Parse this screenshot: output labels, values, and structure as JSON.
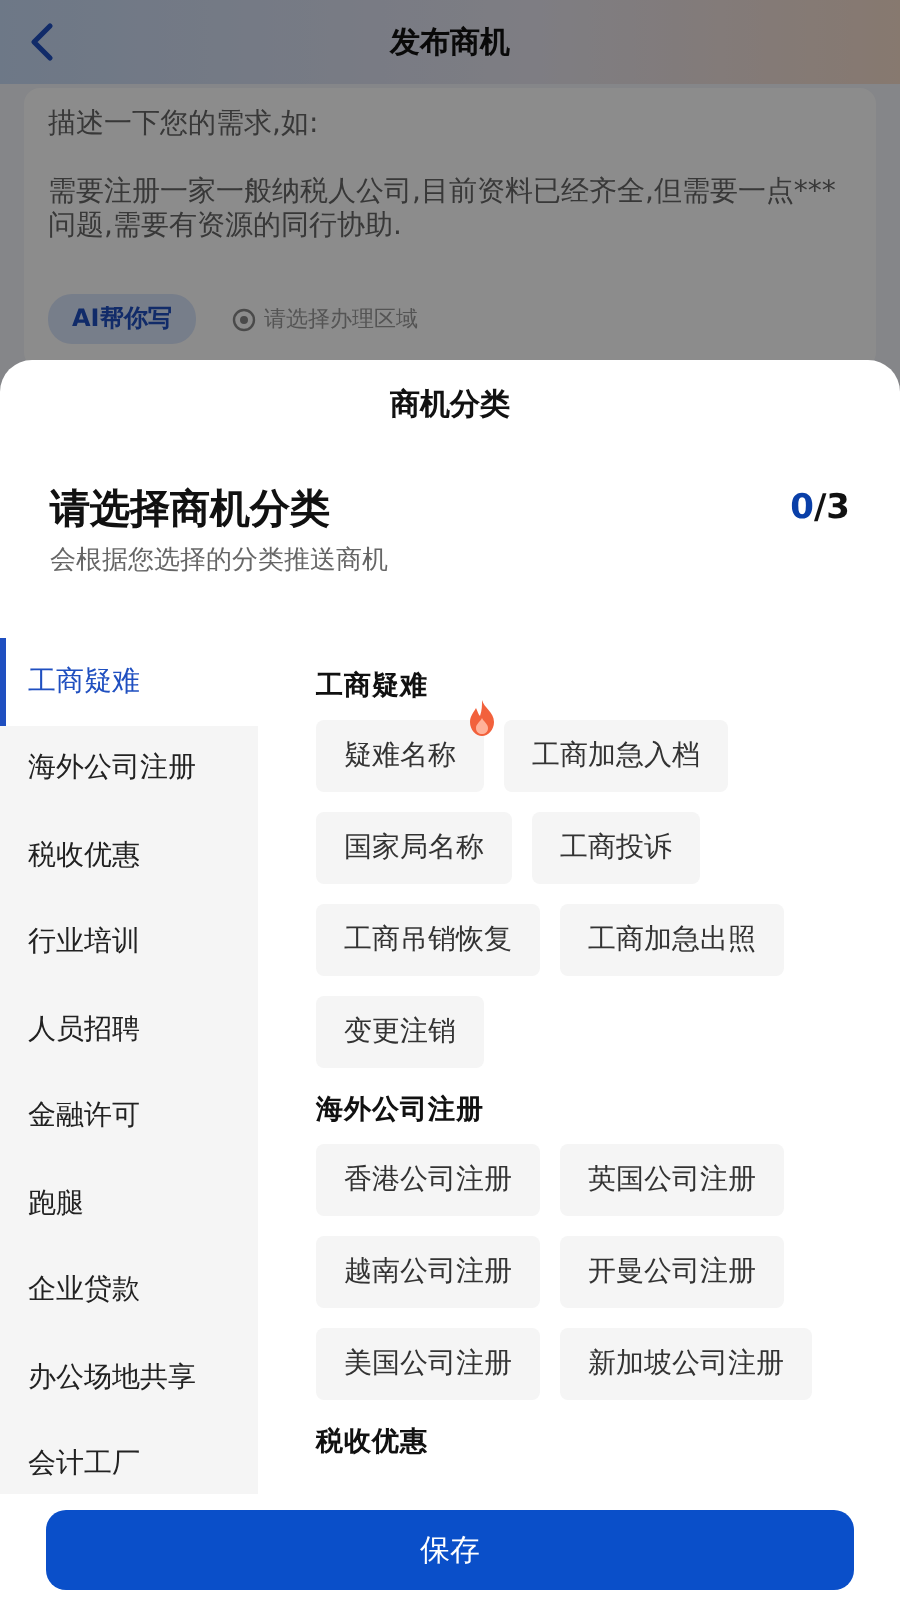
{
  "header": {
    "title": "发布商机"
  },
  "description": {
    "hint_title": "描述一下您的需求,如:",
    "hint_example": "需要注册一家一般纳税人公司,目前资料已经齐全,但需要一点***问题,需要有资源的同行协助.",
    "ai_button": "AI帮你写",
    "region_picker": "请选择办理区域"
  },
  "sheet": {
    "title": "商机分类",
    "heading": "请选择商机分类",
    "count": "0",
    "limit": "/3",
    "subtitle": "会根据您选择的分类推送商机",
    "categories": [
      {
        "label": "工商疑难",
        "selected": true
      },
      {
        "label": "海外公司注册",
        "selected": false
      },
      {
        "label": "税收优惠",
        "selected": false
      },
      {
        "label": "行业培训",
        "selected": false
      },
      {
        "label": "人员招聘",
        "selected": false
      },
      {
        "label": "金融许可",
        "selected": false
      },
      {
        "label": "跑腿",
        "selected": false
      },
      {
        "label": "企业贷款",
        "selected": false
      },
      {
        "label": "办公场地共享",
        "selected": false
      },
      {
        "label": "会计工厂",
        "selected": false
      }
    ],
    "sections": [
      {
        "title": "工商疑难",
        "tags": [
          {
            "label": "疑难名称",
            "hot": true
          },
          {
            "label": "工商加急入档",
            "hot": false
          },
          {
            "label": "国家局名称",
            "hot": false
          },
          {
            "label": "工商投诉",
            "hot": false
          },
          {
            "label": "工商吊销恢复",
            "hot": false
          },
          {
            "label": "工商加急出照",
            "hot": false
          },
          {
            "label": "变更注销",
            "hot": false
          }
        ]
      },
      {
        "title": "海外公司注册",
        "tags": [
          {
            "label": "香港公司注册",
            "hot": false
          },
          {
            "label": "英国公司注册",
            "hot": false
          },
          {
            "label": "越南公司注册",
            "hot": false
          },
          {
            "label": "开曼公司注册",
            "hot": false
          },
          {
            "label": "美国公司注册",
            "hot": false
          },
          {
            "label": "新加坡公司注册",
            "hot": false
          }
        ]
      },
      {
        "title": "税收优惠"
      }
    ],
    "save_button": "保存"
  }
}
